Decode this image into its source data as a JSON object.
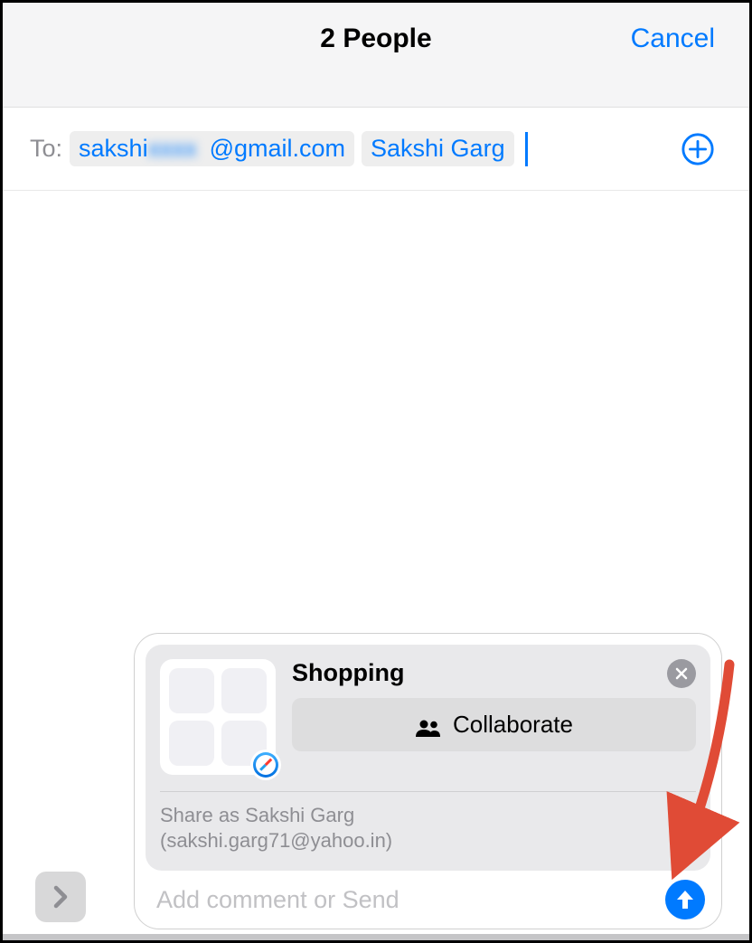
{
  "header": {
    "title": "2 People",
    "cancel_label": "Cancel"
  },
  "to_field": {
    "label": "To:",
    "recipients": [
      {
        "prefix": "sakshi",
        "blurred": "xxxx",
        "suffix": "@gmail.com"
      },
      {
        "full": "Sakshi Garg"
      }
    ]
  },
  "attachment": {
    "title": "Shopping",
    "collab_label": "Collaborate",
    "share_as_line1": "Share as Sakshi Garg",
    "share_as_line2": "(sakshi.garg71@yahoo.in)"
  },
  "compose": {
    "placeholder": "Add comment or Send"
  }
}
